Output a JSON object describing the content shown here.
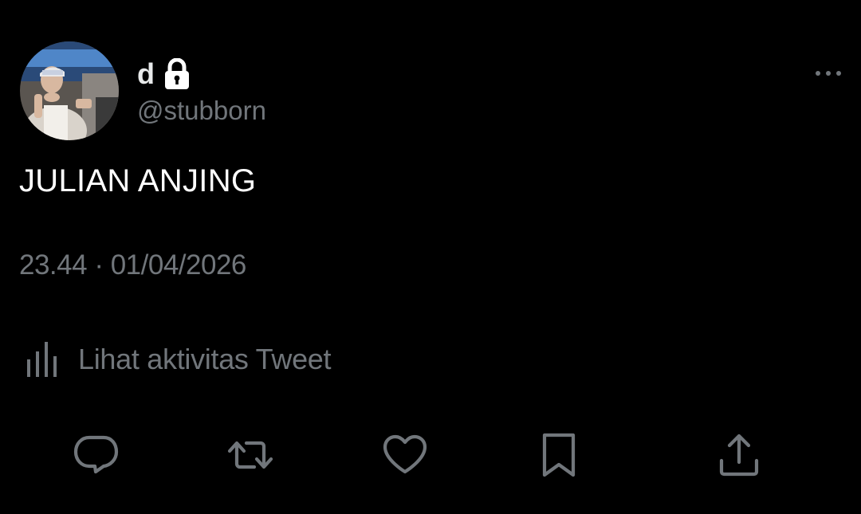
{
  "user": {
    "display_name": "d",
    "handle": "@stubborn",
    "avatar_icon": "user-avatar",
    "protected_icon": "lock-icon"
  },
  "tweet": {
    "text": "JULIAN ANJING",
    "time": "23.44",
    "separator": "·",
    "date": "01/04/2026"
  },
  "activity": {
    "label": "Lihat aktivitas Tweet",
    "icon": "analytics-icon"
  },
  "actions": [
    {
      "name": "reply",
      "icon": "reply-icon"
    },
    {
      "name": "retweet",
      "icon": "retweet-icon"
    },
    {
      "name": "like",
      "icon": "heart-icon"
    },
    {
      "name": "bookmark",
      "icon": "bookmark-icon"
    },
    {
      "name": "share",
      "icon": "share-icon"
    }
  ],
  "colors": {
    "background": "#000000",
    "primary_text": "#e7e9ea",
    "secondary_text": "#71767b"
  }
}
